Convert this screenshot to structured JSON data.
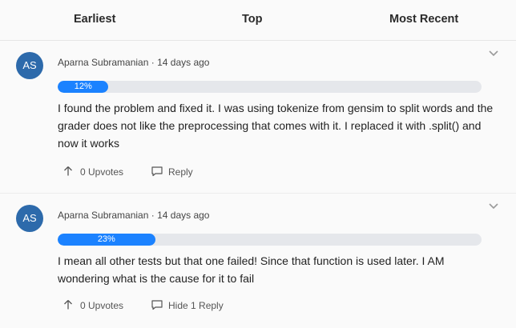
{
  "tabs": [
    "Earliest",
    "Top",
    "Most Recent"
  ],
  "posts": [
    {
      "avatar_initials": "AS",
      "author": "Aparna Subramanian",
      "separator": " · ",
      "time": "14 days ago",
      "progress_label": "12%",
      "progress_value": 0.12,
      "body": "I found the problem and fixed it. I was using tokenize from gensim to split words and the grader does not like the preprocessing that comes with it. I replaced it with .split() and now it works",
      "upvotes_label": "0 Upvotes",
      "reply_label": "Reply"
    },
    {
      "avatar_initials": "AS",
      "author": "Aparna Subramanian",
      "separator": " · ",
      "time": "14 days ago",
      "progress_label": "23%",
      "progress_value": 0.23,
      "body": "I mean all other tests but that one failed! Since that function is used later. I AM wondering what is the cause for it to fail",
      "upvotes_label": "0 Upvotes",
      "reply_label": "Hide 1 Reply"
    }
  ],
  "colors": {
    "accent": "#1b82ff",
    "avatar_bg": "#2d6aab",
    "track": "#e5e7eb"
  },
  "icons": [
    "chevron-down-icon",
    "upvote-arrow-icon",
    "reply-bubble-icon"
  ]
}
